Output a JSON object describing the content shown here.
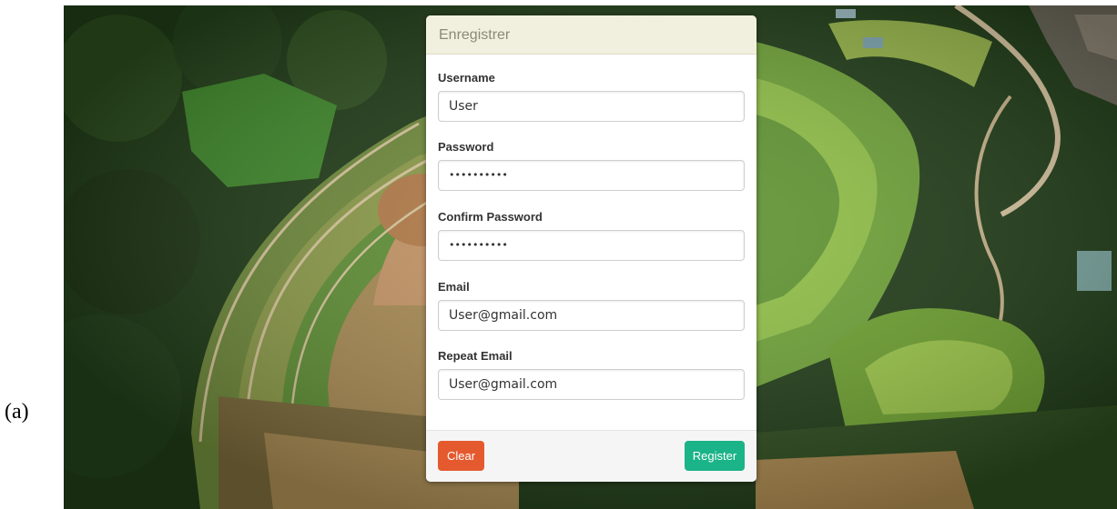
{
  "caption": "(a)",
  "form": {
    "title": "Enregistrer",
    "fields": [
      {
        "label": "Username",
        "value": "User"
      },
      {
        "label": "Password",
        "value": "••••••••••"
      },
      {
        "label": "Confirm Password",
        "value": "••••••••••"
      },
      {
        "label": "Email",
        "value": "User@gmail.com"
      },
      {
        "label": "Repeat Email",
        "value": "User@gmail.com"
      }
    ],
    "buttons": {
      "clear": "Clear",
      "register": "Register"
    }
  },
  "colors": {
    "header_bg": "#f1efdd",
    "clear_button": "#e45a2e",
    "register_button": "#1bb388",
    "background_forest": "#243f1a"
  },
  "background": {
    "icon": "aerial-landfill-photo-icon"
  }
}
